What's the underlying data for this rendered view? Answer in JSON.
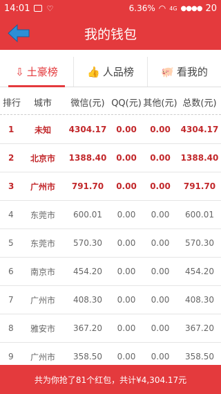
{
  "status_bar": {
    "time": "14:01",
    "network_speed": "6.36",
    "speed_unit": "%",
    "network_type": "4G",
    "battery": "20"
  },
  "app_bar": {
    "title": "我的钱包",
    "back_icon": "back-arrow-icon"
  },
  "tabs": [
    {
      "label": "土豪榜",
      "icon": "sort-down-icon",
      "active": true
    },
    {
      "label": "人品榜",
      "icon": "thumb-up-icon",
      "active": false
    },
    {
      "label": "看我的",
      "icon": "piggy-bank-icon",
      "active": false
    }
  ],
  "table": {
    "headers": [
      "排行",
      "城市",
      "微信(元)",
      "QQ(元)",
      "其他(元)",
      "总数(元)"
    ],
    "rows": [
      {
        "rank": "1",
        "city": "未知",
        "wechat": "4304.17",
        "qq": "0.00",
        "other": "0.00",
        "total": "4304.17"
      },
      {
        "rank": "2",
        "city": "北京市",
        "wechat": "1388.40",
        "qq": "0.00",
        "other": "0.00",
        "total": "1388.40"
      },
      {
        "rank": "3",
        "city": "广州市",
        "wechat": "791.70",
        "qq": "0.00",
        "other": "0.00",
        "total": "791.70"
      },
      {
        "rank": "4",
        "city": "东莞市",
        "wechat": "600.01",
        "qq": "0.00",
        "other": "0.00",
        "total": "600.01"
      },
      {
        "rank": "5",
        "city": "东莞市",
        "wechat": "570.30",
        "qq": "0.00",
        "other": "0.00",
        "total": "570.30"
      },
      {
        "rank": "6",
        "city": "南京市",
        "wechat": "454.20",
        "qq": "0.00",
        "other": "0.00",
        "total": "454.20"
      },
      {
        "rank": "7",
        "city": "广州市",
        "wechat": "408.30",
        "qq": "0.00",
        "other": "0.00",
        "total": "408.30"
      },
      {
        "rank": "8",
        "city": "雅安市",
        "wechat": "367.20",
        "qq": "0.00",
        "other": "0.00",
        "total": "367.20"
      },
      {
        "rank": "9",
        "city": "广州市",
        "wechat": "358.50",
        "qq": "0.00",
        "other": "0.00",
        "total": "358.50"
      }
    ]
  },
  "footer": {
    "summary": "共为你抢了81个红包，共计¥4,304.17元"
  },
  "colors": {
    "primary": "#e43a3d",
    "top_rank": "#c2282b",
    "back_arrow": "#2d8fd6"
  }
}
